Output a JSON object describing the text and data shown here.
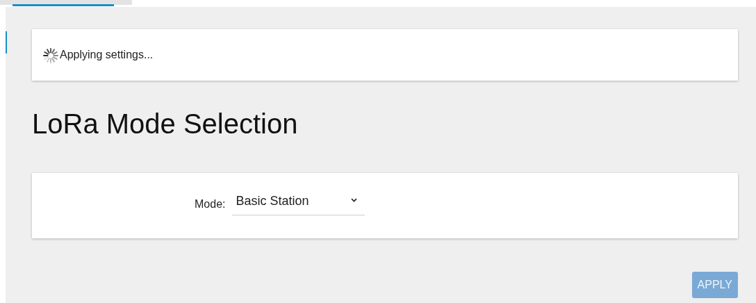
{
  "status": {
    "text": "Applying settings...",
    "busy": true
  },
  "page": {
    "title": "LoRa Mode Selection"
  },
  "form": {
    "label": "Mode:",
    "value": "Basic Station"
  },
  "buttons": [
    {
      "label": "APPLY",
      "disabled": true
    }
  ]
}
